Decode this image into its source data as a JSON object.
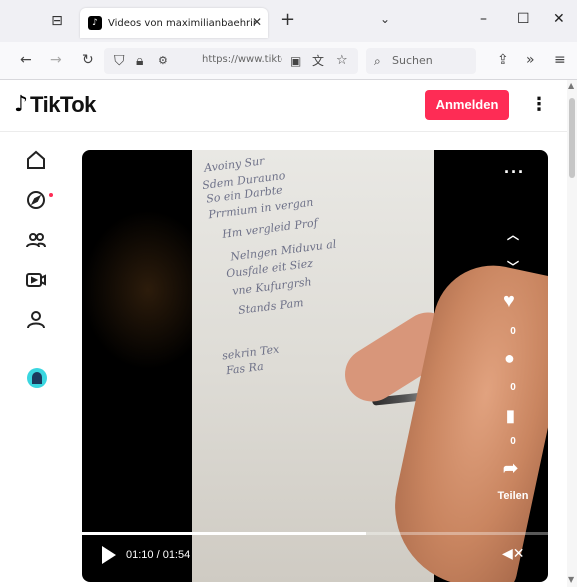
{
  "browser": {
    "tab_title": "Videos von maximilianbaehring",
    "tab_favicon": "♪",
    "url": "https://www.tiktok",
    "search_placeholder": "Suchen"
  },
  "header": {
    "logo_mark": "♪",
    "logo_text": "TikTok",
    "login_label": "Anmelden",
    "more_icon": "more-vertical-icon"
  },
  "sidebar": {
    "items": [
      {
        "name": "home-icon"
      },
      {
        "name": "explore-icon"
      },
      {
        "name": "following-icon"
      },
      {
        "name": "live-icon"
      },
      {
        "name": "profile-icon"
      },
      {
        "name": "account-avatar"
      }
    ]
  },
  "video": {
    "handwriting": [
      "Avoiny  Sur",
      "Sdem   Durauno",
      "So ein  Darbte",
      "Prrmium  in  vergan",
      "Hm  vergleid  Prof",
      "Nelngen  Miduvu  al",
      "Ousfale  eit  Siez",
      "vne  Kufurgrsh",
      "Stands  Pam",
      "sekrin  Tex",
      "Fas  Ra"
    ],
    "likes": "0",
    "comments": "0",
    "saves": "0",
    "share_label": "Teilen",
    "time": "01:10 / 01:54",
    "progress": 0.61
  }
}
